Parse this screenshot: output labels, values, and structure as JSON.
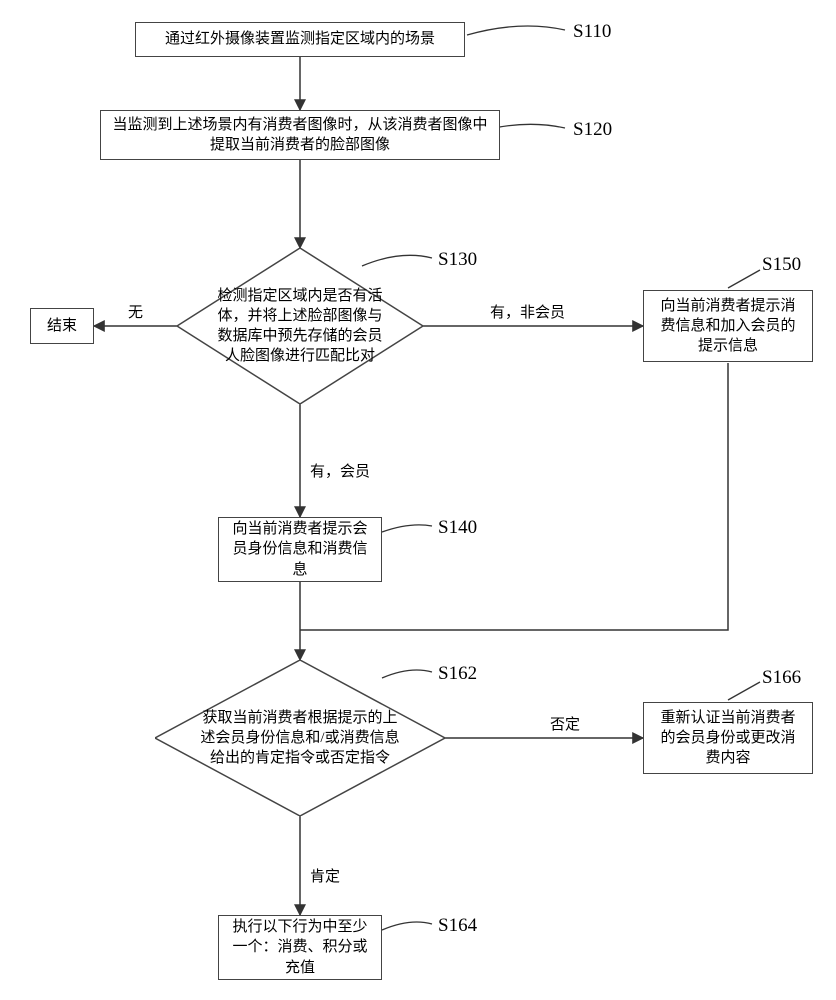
{
  "chart_data": {
    "type": "flowchart",
    "nodes": [
      {
        "id": "S110",
        "label": "S110",
        "type": "process",
        "text": "通过红外摄像装置监测指定区域内的场景"
      },
      {
        "id": "S120",
        "label": "S120",
        "type": "process",
        "text": "当监测到上述场景内有消费者图像时，从该消费者图像中提取当前消费者的脸部图像"
      },
      {
        "id": "S130",
        "label": "S130",
        "type": "decision",
        "text": "检测指定区域内是否有活体，并将上述脸部图像与数据库中预先存储的会员人脸图像进行匹配比对"
      },
      {
        "id": "S140",
        "label": "S140",
        "type": "process",
        "text": "向当前消费者提示会员身份信息和消费信息"
      },
      {
        "id": "S150",
        "label": "S150",
        "type": "process",
        "text": "向当前消费者提示消费信息和加入会员的提示信息"
      },
      {
        "id": "S162",
        "label": "S162",
        "type": "decision",
        "text": "获取当前消费者根据提示的上述会员身份信息和/或消费信息给出的肯定指令或否定指令"
      },
      {
        "id": "S164",
        "label": "S164",
        "type": "process",
        "text": "执行以下行为中至少一个：消费、积分或充值"
      },
      {
        "id": "S166",
        "label": "S166",
        "type": "process",
        "text": "重新认证当前消费者的会员身份或更改消费内容"
      },
      {
        "id": "END",
        "label": "",
        "type": "terminator",
        "text": "结束"
      }
    ],
    "edges": [
      {
        "from": "S110",
        "to": "S120"
      },
      {
        "from": "S120",
        "to": "S130"
      },
      {
        "from": "S130",
        "to": "END",
        "label": "无"
      },
      {
        "from": "S130",
        "to": "S150",
        "label": "有，非会员"
      },
      {
        "from": "S130",
        "to": "S140",
        "label": "有，会员"
      },
      {
        "from": "S140",
        "to": "S162"
      },
      {
        "from": "S150",
        "to": "S162"
      },
      {
        "from": "S162",
        "to": "S166",
        "label": "否定"
      },
      {
        "from": "S162",
        "to": "S164",
        "label": "肯定"
      }
    ]
  },
  "nodes": {
    "s110": {
      "text": "通过红外摄像装置监测指定区域内的场景",
      "label": "S110"
    },
    "s120": {
      "text": "当监测到上述场景内有消费者图像时，从该消费者图像中提取当前消费者的脸部图像",
      "label": "S120"
    },
    "s130": {
      "text": "检测指定区域内是否有活体，并将上述脸部图像与数据库中预先存储的会员人脸图像进行匹配比对",
      "label": "S130"
    },
    "s140": {
      "text": "向当前消费者提示会员身份信息和消费信息",
      "label": "S140"
    },
    "s150": {
      "text": "向当前消费者提示消费信息和加入会员的提示信息",
      "label": "S150"
    },
    "s162": {
      "text": "获取当前消费者根据提示的上述会员身份信息和/或消费信息给出的肯定指令或否定指令",
      "label": "S162"
    },
    "s164": {
      "text": "执行以下行为中至少一个：消费、积分或充值",
      "label": "S164"
    },
    "s166": {
      "text": "重新认证当前消费者的会员身份或更改消费内容",
      "label": "S166"
    },
    "end": {
      "text": "结束"
    }
  },
  "edge_labels": {
    "s130_end": "无",
    "s130_s150": "有，非会员",
    "s130_s140": "有，会员",
    "s162_s166": "否定",
    "s162_s164": "肯定"
  }
}
